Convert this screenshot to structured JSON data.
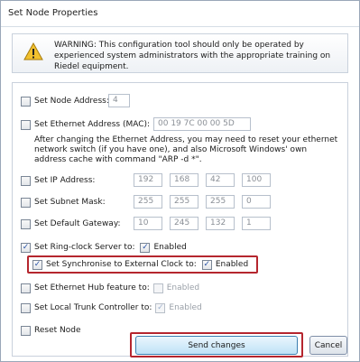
{
  "window": {
    "title": "Set Node Properties"
  },
  "warning": {
    "text": "WARNING: This configuration tool should only be operated by experienced system administrators with the appropriate training on Riedel equipment."
  },
  "node_address": {
    "label": "Set Node Address:",
    "value": "4",
    "checked": false
  },
  "mac": {
    "label": "Set Ethernet Address (MAC):",
    "value": "00 19 7C 00 00 5D",
    "checked": false,
    "note": "After changing the Ethernet Address, you may need to reset your ethernet network switch (if you have one), and also Microsoft Windows' own address cache with command \"ARP -d *\"."
  },
  "ip": {
    "label": "Set IP Address:",
    "octets": [
      "192",
      "168",
      "42",
      "100"
    ],
    "checked": false
  },
  "subnet": {
    "label": "Set Subnet Mask:",
    "octets": [
      "255",
      "255",
      "255",
      "0"
    ],
    "checked": false
  },
  "gateway": {
    "label": "Set Default Gateway:",
    "octets": [
      "10",
      "245",
      "132",
      "1"
    ],
    "checked": false
  },
  "ring_clock": {
    "label": "Set Ring-clock Server to:",
    "checked": true,
    "enabled_label": "Enabled",
    "enabled_checked": true
  },
  "sync_clock": {
    "label": "Set Synchronise to External Clock to:",
    "checked": true,
    "enabled_label": "Enabled",
    "enabled_checked": true
  },
  "hub": {
    "label": "Set Ethernet Hub feature to:",
    "checked": false,
    "enabled_label": "Enabled",
    "enabled_checked": false
  },
  "trunk": {
    "label": "Set Local Trunk Controller to:",
    "checked": false,
    "enabled_label": "Enabled",
    "enabled_checked": true
  },
  "reset": {
    "label": "Reset Node",
    "checked": false
  },
  "buttons": {
    "send": "Send changes",
    "cancel": "Cancel"
  },
  "colors": {
    "highlight": "#b5262e",
    "accent": "#3c7fb1"
  },
  "icons": {
    "warning": "warning-triangle-icon"
  }
}
